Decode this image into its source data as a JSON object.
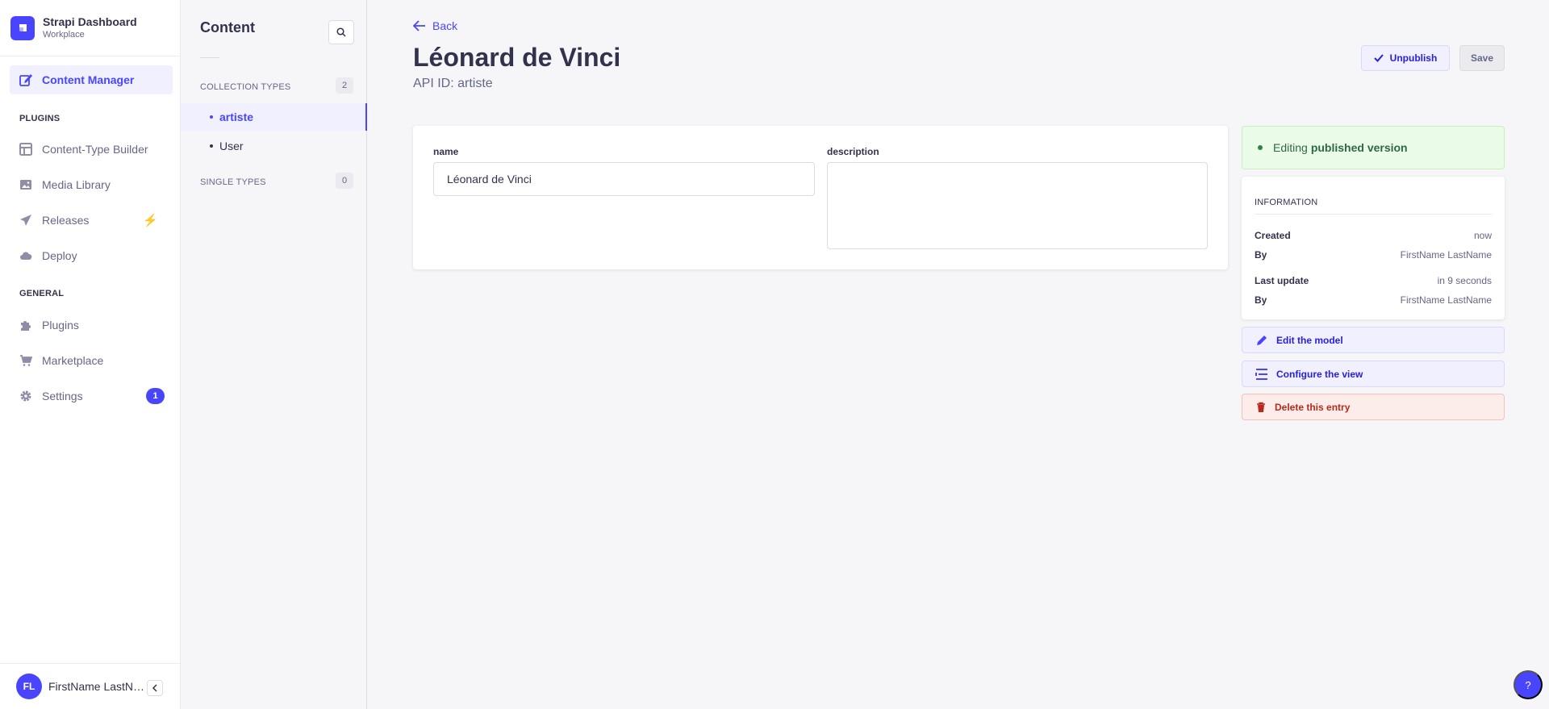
{
  "brand": {
    "name": "Strapi Dashboard",
    "workspace": "Workplace"
  },
  "mainnav": {
    "active_item": "Content Manager",
    "plugins_label": "PLUGINS",
    "general_label": "GENERAL",
    "content_manager": "Content Manager",
    "plugins_items": [
      "Content-Type Builder",
      "Media Library",
      "Releases",
      "Deploy"
    ],
    "general_items": [
      "Plugins",
      "Marketplace",
      "Settings"
    ],
    "settings_badge": "1",
    "releases_icon": "lightning-bolt-icon"
  },
  "user": {
    "initials": "FL",
    "name": "FirstName LastName"
  },
  "subnav": {
    "title": "Content",
    "collection_types_label": "COLLECTION TYPES",
    "collection_types_count": "2",
    "collection_types": [
      "artiste",
      "User"
    ],
    "active_collection": "artiste",
    "single_types_label": "SINGLE TYPES",
    "single_types_count": "0"
  },
  "header": {
    "back_label": "Back",
    "title": "Léonard de Vinci",
    "api_id": "API ID: artiste",
    "unpublish_label": "Unpublish",
    "save_label": "Save"
  },
  "form": {
    "name_label": "name",
    "name_value": "Léonard de Vinci",
    "description_label": "description",
    "description_value": ""
  },
  "status": {
    "prefix": "Editing",
    "version": "published version"
  },
  "information": {
    "title": "INFORMATION",
    "created_label": "Created",
    "created_value": "now",
    "created_by_label": "By",
    "created_by_value": "FirstName LastName",
    "updated_label": "Last update",
    "updated_value": "in 9 seconds",
    "updated_by_label": "By",
    "updated_by_value": "FirstName LastName"
  },
  "actions": {
    "edit_model": "Edit the model",
    "configure_view": "Configure the view",
    "delete_entry": "Delete this entry"
  },
  "help_label": "?",
  "colors": {
    "primary": "#4945ff",
    "success_bg": "#eafbe7",
    "danger": "#b72b1a"
  }
}
